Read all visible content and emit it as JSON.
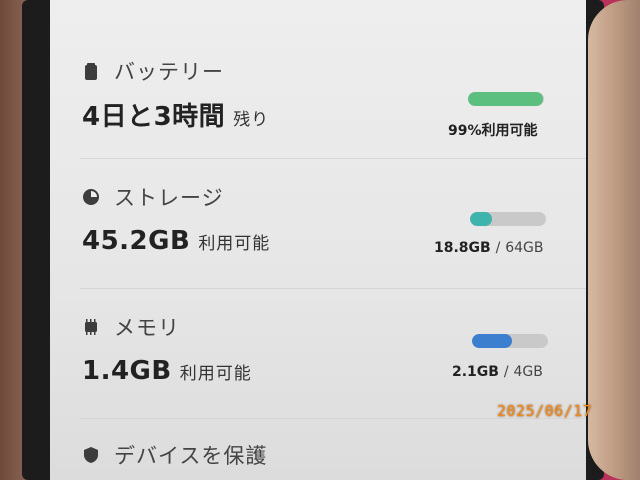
{
  "battery": {
    "title": "バッテリー",
    "remaining_main": "4日と3時間",
    "remaining_suffix": "残り",
    "usage_text": "99%利用可能",
    "level_fraction": 0.99,
    "bar_color": "#5cbf7f",
    "icon": "battery-icon"
  },
  "storage": {
    "title": "ストレージ",
    "available_main": "45.2GB",
    "available_suffix": "利用可能",
    "used": "18.8GB",
    "separator": "/",
    "total": "64GB",
    "used_fraction": 0.29,
    "bar_color": "#3fb3ad",
    "icon": "storage-pie-icon"
  },
  "memory": {
    "title": "メモリ",
    "available_main": "1.4GB",
    "available_suffix": "利用可能",
    "used": "2.1GB",
    "separator": "/",
    "total": "4GB",
    "used_fraction": 0.53,
    "bar_color": "#3c7fcf",
    "icon": "memory-chip-icon"
  },
  "protect": {
    "title": "デバイスを保護",
    "icon": "shield-icon"
  },
  "photo_date_stamp": "2025/06/17"
}
